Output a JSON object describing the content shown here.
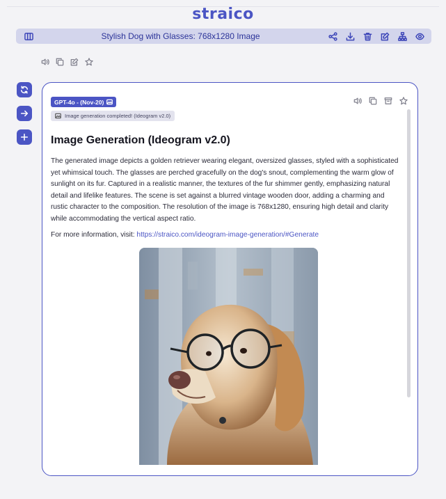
{
  "app": {
    "logo": "straico"
  },
  "titlebar": {
    "title": "Stylish Dog with Glasses: 768x1280 Image"
  },
  "icons": {
    "panel": "columns-icon",
    "share": "share-icon",
    "download": "download-icon",
    "delete": "trash-icon",
    "edit": "edit-icon",
    "sitemap": "sitemap-icon",
    "view": "eye-icon"
  },
  "message": {
    "model": "GPT-4o - (Nov-20)",
    "status": "Image generation completed! (Ideogram v2.0)",
    "heading": "Image Generation (Ideogram v2.0)",
    "body": "The generated image depicts a golden retriever wearing elegant, oversized glasses, styled with a sophisticated yet whimsical touch. The glasses are perched gracefully on the dog's snout, complementing the warm glow of sunlight on its fur. Captured in a realistic manner, the textures of the fur shimmer gently, emphasizing natural detail and lifelike features. The scene is set against a blurred vintage wooden door, adding a charming and rustic character to the composition. The resolution of the image is 768x1280, ensuring high detail and clarity while accommodating the vertical aspect ratio.",
    "more_prefix": "For more information, visit: ",
    "more_link": "https://straico.com/ideogram-image-generation/#Generate"
  },
  "colors": {
    "accent": "#4b55c4",
    "titlebar_bg": "#d3d5ec"
  }
}
